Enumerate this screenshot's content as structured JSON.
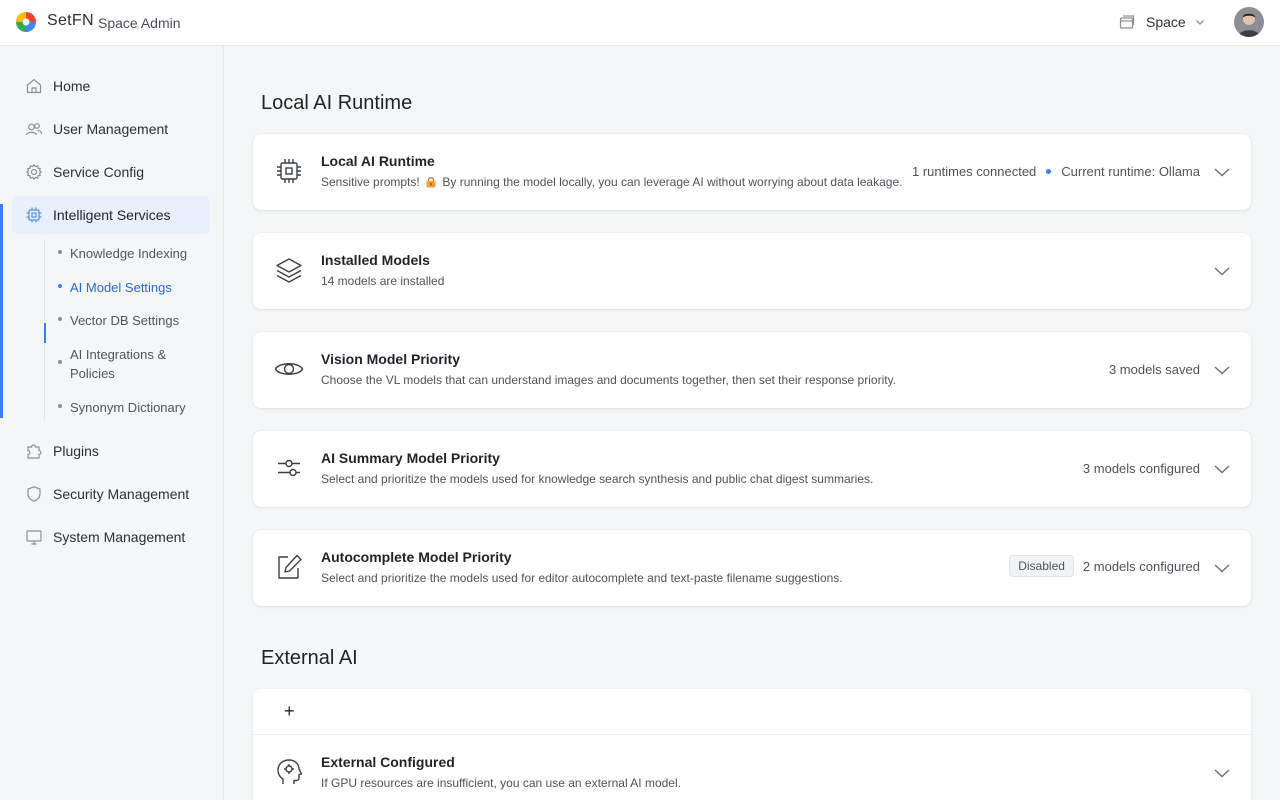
{
  "header": {
    "brand": "SetFN",
    "product": "Space Admin",
    "space_label": "Space",
    "logo_colors": [
      "#e94335",
      "#fbbc04",
      "#34a853",
      "#4285f4"
    ]
  },
  "sidebar": {
    "items": [
      {
        "label": "Home",
        "icon": "home-icon"
      },
      {
        "label": "User Management",
        "icon": "users-icon"
      },
      {
        "label": "Service Config",
        "icon": "gear-icon"
      },
      {
        "label": "Intelligent Services",
        "icon": "chip-icon",
        "active": true
      },
      {
        "label": "Plugins",
        "icon": "puzzle-icon"
      },
      {
        "label": "Security Management",
        "icon": "shield-icon"
      },
      {
        "label": "System Management",
        "icon": "monitor-icon"
      }
    ],
    "sub_items": [
      {
        "label": "Knowledge Indexing"
      },
      {
        "label": "AI Model Settings",
        "active": true
      },
      {
        "label": "Vector DB Settings"
      },
      {
        "label": "AI Integrations & Policies"
      },
      {
        "label": "Synonym Dictionary"
      }
    ]
  },
  "main": {
    "local_section_title": "Local AI Runtime",
    "cards": [
      {
        "title": "Local AI Runtime",
        "desc_before": "Sensitive prompts!",
        "desc_after": "By running the model locally, you can leverage AI without worrying about data leakage.",
        "status_left": "1 runtimes connected",
        "status_right": "Current runtime: Ollama",
        "icon": "cpu-icon"
      },
      {
        "title": "Installed Models",
        "desc": "14 models are installed",
        "icon": "layers-icon"
      },
      {
        "title": "Vision Model Priority",
        "desc": "Choose the VL models that can understand images and documents together, then set their response priority.",
        "status": "3 models saved",
        "icon": "eye-icon"
      },
      {
        "title": "AI Summary Model Priority",
        "desc": "Select and prioritize the models used for knowledge search synthesis and public chat digest summaries.",
        "status": "3 models configured",
        "icon": "sliders-icon"
      },
      {
        "title": "Autocomplete Model Priority",
        "desc": "Select and prioritize the models used for editor autocomplete and text-paste filename suggestions.",
        "badge": "Disabled",
        "status": "2 models configured",
        "icon": "edit-icon"
      }
    ],
    "external_section_title": "External AI",
    "external": {
      "add_label": "+",
      "title": "External Configured",
      "desc": "If GPU resources are insufficient, you can use an external AI model.",
      "icon": "head-icon"
    },
    "accent_color": "#3e7ef6"
  }
}
